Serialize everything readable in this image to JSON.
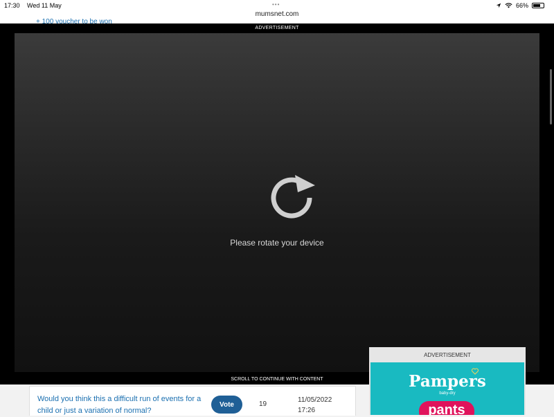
{
  "status_bar": {
    "time": "17:30",
    "date": "Wed 11 May",
    "battery": "66%",
    "url": "mumsnet.com"
  },
  "page": {
    "partial_link": "+ 100 voucher to be won"
  },
  "ad_overlay": {
    "label": "ADVERTISEMENT",
    "message": "Please rotate your device",
    "scroll_hint": "SCROLL TO CONTINUE WITH CONTENT"
  },
  "thread_row": {
    "question": "Would you think this a difficult run of events for a child or just a variation of normal?",
    "vote_label": "Vote",
    "count": "19",
    "date": "11/05/2022",
    "time": "17:26"
  },
  "side_ad": {
    "label": "ADVERTISEMENT",
    "brand": "Pampers",
    "subbrand": "baby-dry",
    "product": "pants"
  },
  "colors": {
    "link": "#1a6fb0",
    "vote_button": "#1f5f96",
    "ad_teal": "#19bac1",
    "pants_pink": "#e0135b"
  }
}
